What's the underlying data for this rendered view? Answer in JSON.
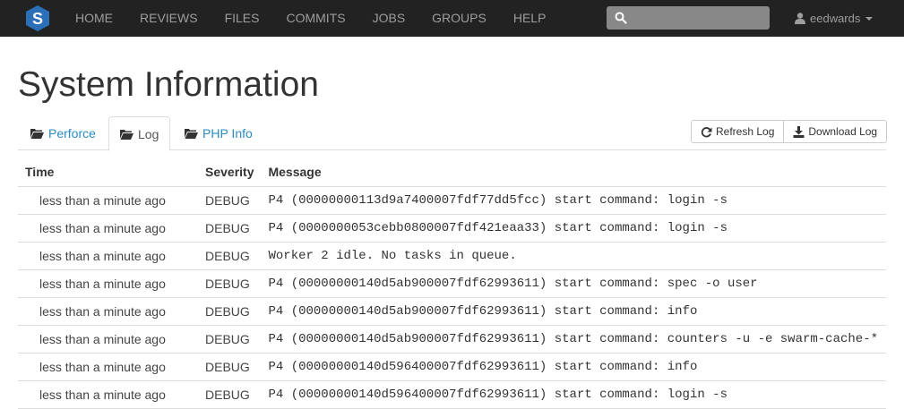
{
  "nav": {
    "items": [
      "HOME",
      "REVIEWS",
      "FILES",
      "COMMITS",
      "JOBS",
      "GROUPS",
      "HELP"
    ],
    "search_placeholder": "",
    "username": "eedwards"
  },
  "colors": {
    "navbar": "#222222",
    "link": "#2a8bc5",
    "logo": "#2a6fb8"
  },
  "page": {
    "title": "System Information"
  },
  "tabs": [
    {
      "label": "Perforce",
      "active": false
    },
    {
      "label": "Log",
      "active": true
    },
    {
      "label": "PHP Info",
      "active": false
    }
  ],
  "buttons": {
    "refresh": "Refresh Log",
    "download": "Download Log"
  },
  "log_table": {
    "headers": [
      "Time",
      "Severity",
      "Message"
    ],
    "rows": [
      {
        "time": "less than a minute ago",
        "severity": "DEBUG",
        "message": "P4 (00000000113d9a7400007fdf77dd5fcc) start command: login -s"
      },
      {
        "time": "less than a minute ago",
        "severity": "DEBUG",
        "message": "P4 (0000000053cebb0800007fdf421eaa33) start command: login -s"
      },
      {
        "time": "less than a minute ago",
        "severity": "DEBUG",
        "message": "Worker 2 idle. No tasks in queue."
      },
      {
        "time": "less than a minute ago",
        "severity": "DEBUG",
        "message": "P4 (00000000140d5ab900007fdf62993611) start command: spec -o user"
      },
      {
        "time": "less than a minute ago",
        "severity": "DEBUG",
        "message": "P4 (00000000140d5ab900007fdf62993611) start command: info"
      },
      {
        "time": "less than a minute ago",
        "severity": "DEBUG",
        "message": "P4 (00000000140d5ab900007fdf62993611) start command: counters -u -e swarm-cache-*"
      },
      {
        "time": "less than a minute ago",
        "severity": "DEBUG",
        "message": "P4 (00000000140d596400007fdf62993611) start command: info"
      },
      {
        "time": "less than a minute ago",
        "severity": "DEBUG",
        "message": "P4 (00000000140d596400007fdf62993611) start command: login -s"
      }
    ]
  }
}
